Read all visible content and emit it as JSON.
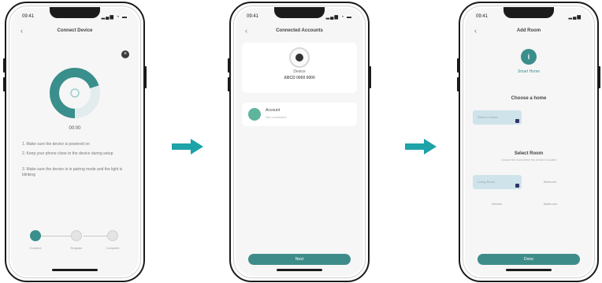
{
  "colors": {
    "teal": "#3a8f8c",
    "arrow": "#1ea3a8",
    "pill": "#3e8c8a"
  },
  "screen1": {
    "time": "09:41",
    "status_icons": "▂▄▆ ◔ ▬",
    "back": "‹",
    "title": "Connect Device",
    "close": "×",
    "ring_label": "00:00",
    "instructions": [
      "1. Make sure the device is powered on",
      "2. Keep your phone close to the device during setup",
      "3. Make sure the device is in pairing mode and the light is blinking"
    ],
    "steps": [
      "Connect",
      "Register",
      "Complete"
    ],
    "progress": 0.7
  },
  "screen2": {
    "time": "09:41",
    "status_icons": "▂▄▆ ◔ ▬",
    "back": "‹",
    "title": "Connected Accounts",
    "device_name": "Device",
    "device_id": "ABCD 0000 0000",
    "account_name": "Account",
    "account_sub": "Not connected",
    "button": "Next"
  },
  "screen3": {
    "time": "09:41",
    "status_icons": "▂▄▆",
    "back": "‹",
    "title": "Add Room",
    "user_initial": "i",
    "user_label": "Smart Home",
    "section1": "Choose a home",
    "field1": "Select a home",
    "section2": "Select Room",
    "section2_sub": "Choose the room where the device is located",
    "field2": "Living Room",
    "opt1": "Bedroom",
    "opt2": "Kitchen",
    "opt3": "Bathroom",
    "button": "Done"
  }
}
